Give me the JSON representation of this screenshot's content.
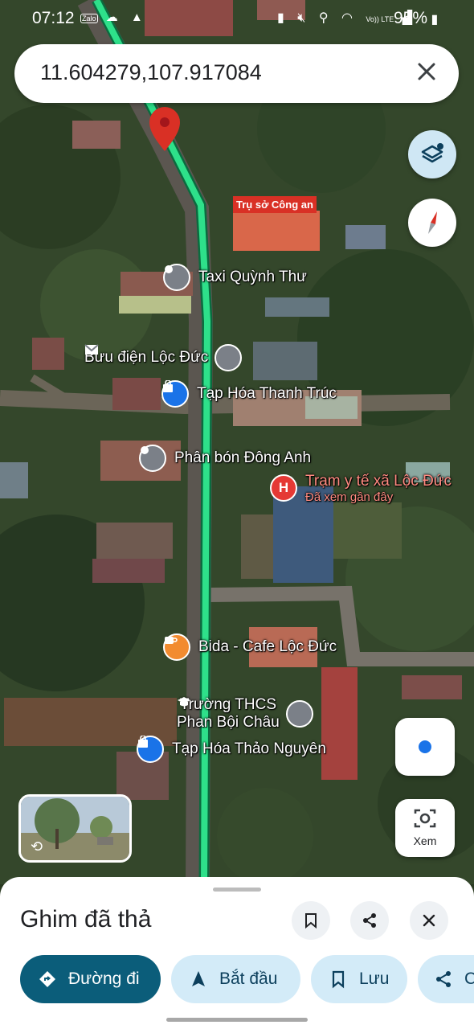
{
  "status_bar": {
    "time": "07:12",
    "battery": "95%",
    "left_icons": [
      "zalo-icon",
      "cloud-icon",
      "alert-icon"
    ],
    "right_icons": [
      "sim-icon",
      "mute-icon",
      "location-icon",
      "wifi-icon",
      "volte-icon",
      "signal-icon",
      "battery-icon"
    ],
    "carrier_badge": "Vo)) LTE"
  },
  "search": {
    "query": "11.604279,107.917084"
  },
  "map": {
    "route_color": "#2ee08a",
    "pin_color": "#d93025",
    "labels": {
      "police": "Trụ sở Công an",
      "taxi": "Taxi Quỳnh Thư",
      "post": "Bưu điện Lộc Đức",
      "grocery1": "Tạp Hóa Thanh Trúc",
      "fertilizer": "Phân bón Đông Anh",
      "health": "Trạm y tế xã Lộc Đức",
      "health_sub": "Đã xem gần đây",
      "cafe": "Bida - Cafe Lộc Đức",
      "school_line1": "Trường THCS",
      "school_line2": "Phan Bội Châu",
      "grocery2": "Tạp Hóa Thảo Nguyên"
    }
  },
  "controls": {
    "lens_label": "Xem"
  },
  "sheet": {
    "title": "Ghim đã thả",
    "chips": {
      "directions": "Đường đi",
      "start": "Bắt đầu",
      "save": "Lưu",
      "share": "C"
    }
  }
}
